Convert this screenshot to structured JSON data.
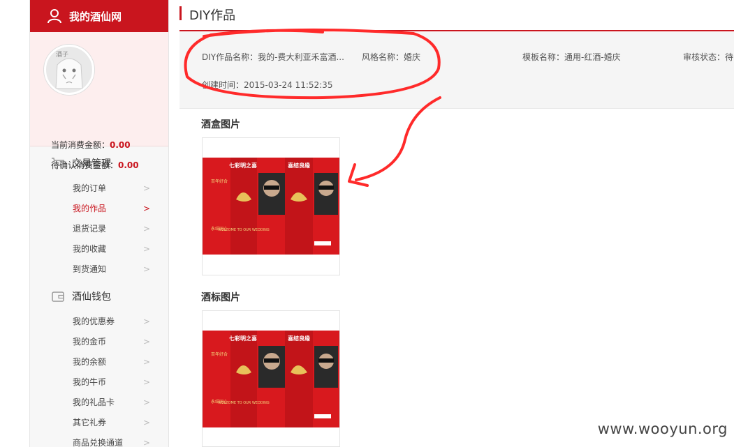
{
  "sidebar": {
    "header": "我的酒仙网",
    "avatar_text": "酒子",
    "current_spend_label": "当前消费金额：",
    "current_spend_value": "0.00",
    "pending_spend_label": "待确认消费金额：",
    "pending_spend_value": "0.00",
    "groups": [
      {
        "title": "交易管理",
        "icon": "cart-icon",
        "items": [
          "我的订单",
          "我的作品",
          "退货记录",
          "我的收藏",
          "到货通知"
        ]
      },
      {
        "title": "酒仙钱包",
        "icon": "wallet-icon",
        "items": [
          "我的优惠券",
          "我的金币",
          "我的余额",
          "我的牛币",
          "我的礼品卡",
          "其它礼券",
          "商品兑换通道"
        ]
      }
    ],
    "active_item": "我的作品"
  },
  "main": {
    "title": "DIY作品",
    "info": {
      "work_name": "DIY作品名称：我的-费大利亚禾富酒...",
      "style_name": "风格名称：婚庆",
      "template_name": "模板名称：通用-红酒-婚庆",
      "review_status": "审核状态：待",
      "created_time": "创建时间：2015-03-24 11:52:35"
    },
    "box_image_label": "酒盒图片",
    "label_image_label": "酒标图片",
    "product_art": {
      "banner_left": "七彩明之喜",
      "banner_right": "喜结良缘",
      "welcome": "WELCOME TO OUR WEDDING",
      "side_left": "百年好合",
      "side_right": "永结同心"
    }
  },
  "watermark": "www.wooyun.org",
  "colors": {
    "accent": "#c9151e",
    "annotation": "#ff2a2a"
  }
}
